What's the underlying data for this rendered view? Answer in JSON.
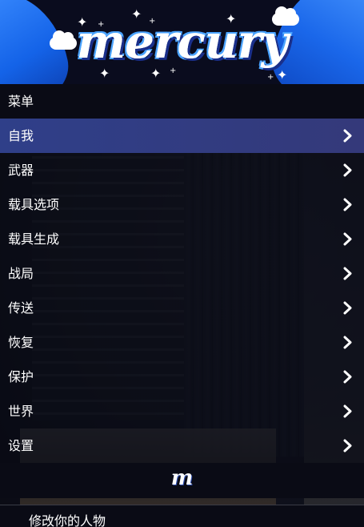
{
  "banner": {
    "logo_text": "mercury"
  },
  "menu": {
    "header": "菜单",
    "items": [
      {
        "label": "自我",
        "selected": true
      },
      {
        "label": "武器"
      },
      {
        "label": "载具选项"
      },
      {
        "label": "载具生成"
      },
      {
        "label": "战局"
      },
      {
        "label": "传送"
      },
      {
        "label": "恢复"
      },
      {
        "label": "保护"
      },
      {
        "label": "世界"
      },
      {
        "label": "设置"
      }
    ],
    "footer_logo": "m",
    "description": "修改你的人物"
  },
  "icons": {
    "item_arrow": "chevron-right-icon"
  },
  "colors": {
    "selected_bg": "#34397a",
    "banner_accent": "#1a67ea",
    "panel_bg": "#0a0b15",
    "text": "#ffffff"
  }
}
